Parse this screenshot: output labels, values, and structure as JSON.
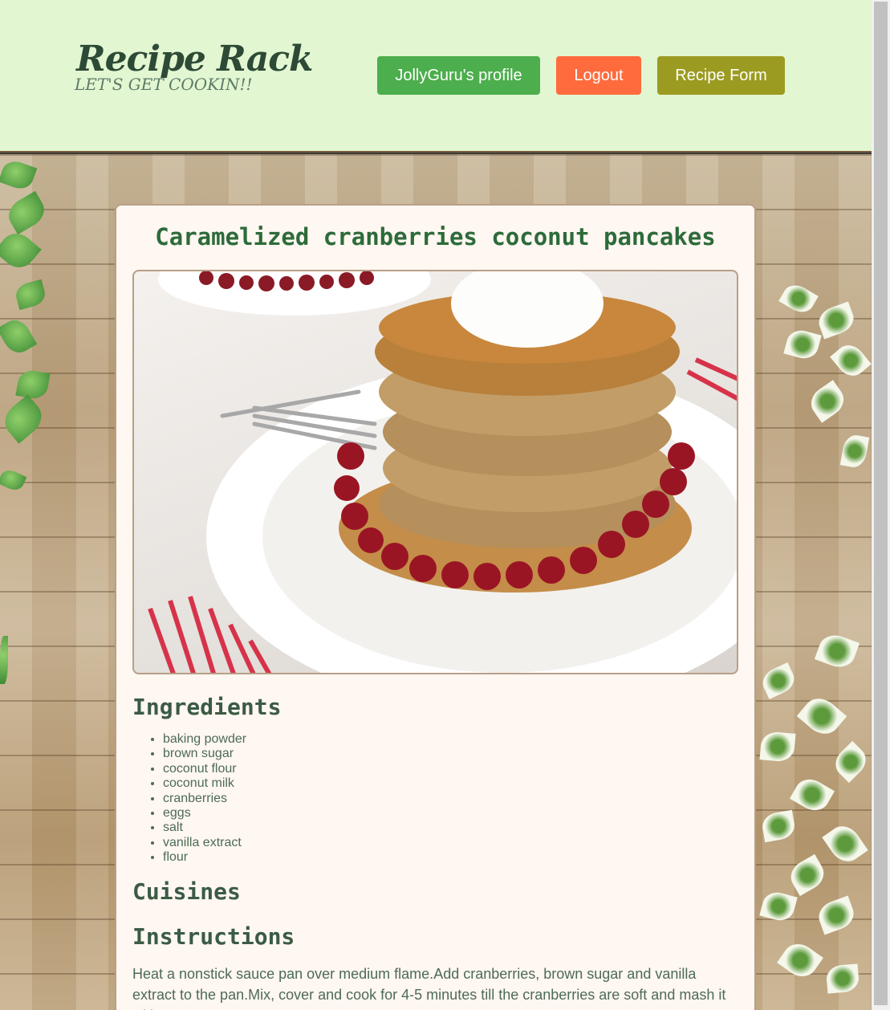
{
  "header": {
    "brand_title": "Recipe Rack",
    "brand_tagline": "LET'S GET COOKIN!!",
    "nav": {
      "profile_label": "JollyGuru's profile",
      "logout_label": "Logout",
      "recipe_form_label": "Recipe Form"
    }
  },
  "recipe": {
    "title": "Caramelized cranberries coconut pancakes",
    "ingredients_heading": "Ingredients",
    "ingredients": [
      "baking powder",
      "brown sugar",
      "coconut flour",
      "coconut milk",
      "cranberries",
      "eggs",
      "salt",
      "vanilla extract",
      "flour"
    ],
    "cuisines_heading": "Cuisines",
    "instructions_heading": "Instructions",
    "instructions_text": "Heat a nonstick sauce pan over medium flame.Add cranberries, brown sugar and vanilla extract to the pan.Mix, cover and cook for 4-5 minutes till the cranberries are soft and mash it with a"
  },
  "colors": {
    "header_bg": "#e2f6d2",
    "profile_button": "#4cae4c",
    "logout_button": "#ff6b3d",
    "recipe_form_button": "#9b9b21",
    "title_color": "#2d6b3a",
    "card_bg": "#fff7f1"
  }
}
